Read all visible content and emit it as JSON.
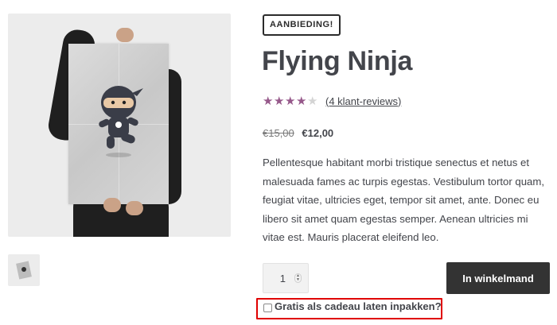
{
  "gallery": {
    "main_image_alt": "Flying Ninja poster",
    "thumbnail_alt": "Flying Ninja thumbnail"
  },
  "product": {
    "badge": "AANBIEDING!",
    "title": "Flying Ninja",
    "rating": {
      "value": 4,
      "max": 5,
      "review_link": "(4 klant-reviews)"
    },
    "price": {
      "regular": "€15,00",
      "sale": "€12,00"
    },
    "description": "Pellentesque habitant morbi tristique senectus et netus et malesuada fames ac turpis egestas. Vestibulum tortor quam, feugiat vitae, ultricies eget, tempor sit amet, ante. Donec eu libero sit amet quam egestas semper. Aenean ultricies mi vitae est. Mauris placerat eleifend leo."
  },
  "cart": {
    "quantity": "1",
    "add_button_label": "In winkelmand",
    "gift_wrap_label": "Gratis als cadeau laten inpakken?",
    "gift_wrap_checked": false
  },
  "colors": {
    "star_on": "#96588a",
    "button_bg": "#333333",
    "highlight_border": "#e00000"
  },
  "icons": {
    "star": "star-icon",
    "spinner": "quantity-spinner-icon"
  }
}
